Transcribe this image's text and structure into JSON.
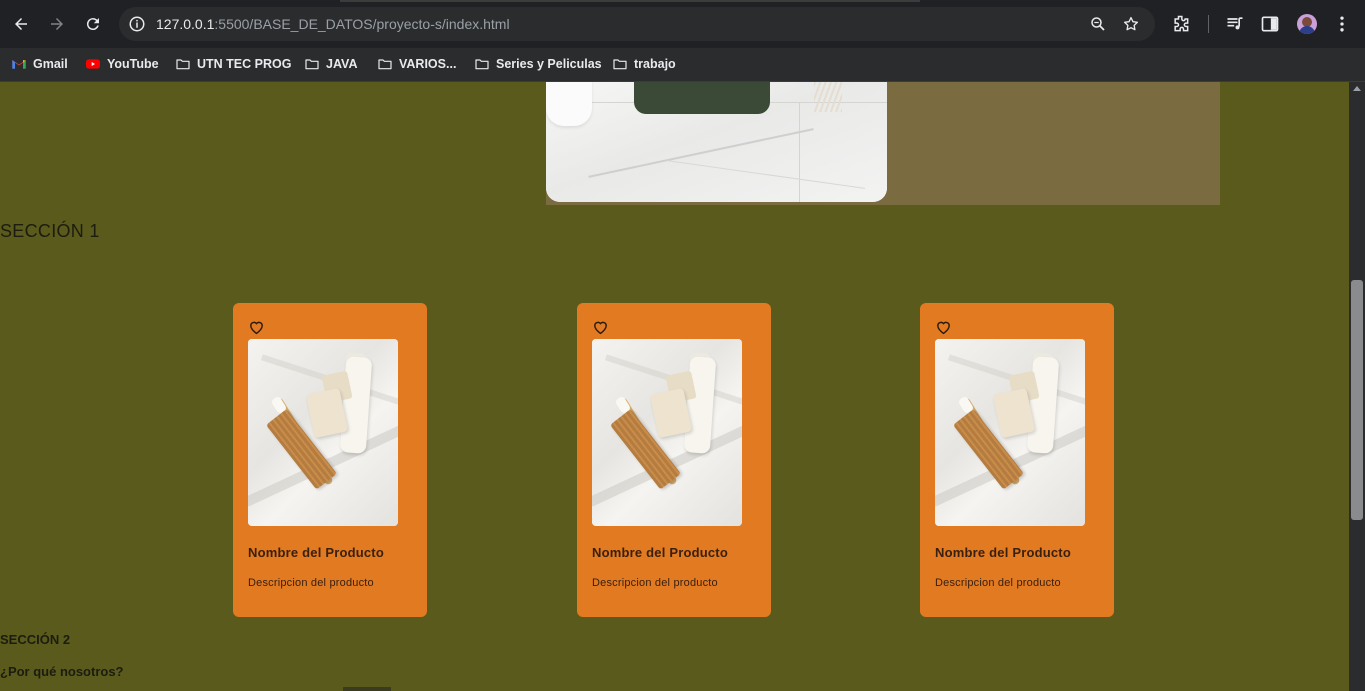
{
  "browser": {
    "url_host": "127.0.0.1",
    "url_rest": ":5500/BASE_DE_DATOS/proyecto-s/index.html",
    "bookmarks": [
      {
        "label": "Gmail",
        "icon": "gmail-icon"
      },
      {
        "label": "YouTube",
        "icon": "youtube-icon"
      },
      {
        "label": "UTN TEC PROG",
        "icon": "folder-icon"
      },
      {
        "label": "JAVA",
        "icon": "folder-icon"
      },
      {
        "label": "VARIOS...",
        "icon": "folder-icon"
      },
      {
        "label": "Series y Peliculas",
        "icon": "folder-icon"
      },
      {
        "label": "trabajo",
        "icon": "folder-icon"
      }
    ]
  },
  "page": {
    "section1_title": "SECCIÓN 1",
    "cards": [
      {
        "name": "Nombre del Producto",
        "description": "Descripcion del producto"
      },
      {
        "name": "Nombre del Producto",
        "description": "Descripcion del producto"
      },
      {
        "name": "Nombre del Producto",
        "description": "Descripcion del producto"
      }
    ],
    "section2_title": "SECCIÓN 2",
    "why_us": "¿Por qué nosotros?"
  },
  "colors": {
    "page_bg": "#5a5a1c",
    "hero_panel": "#7a6c40",
    "card_bg": "#e17a20",
    "chrome_bg": "#202124"
  }
}
